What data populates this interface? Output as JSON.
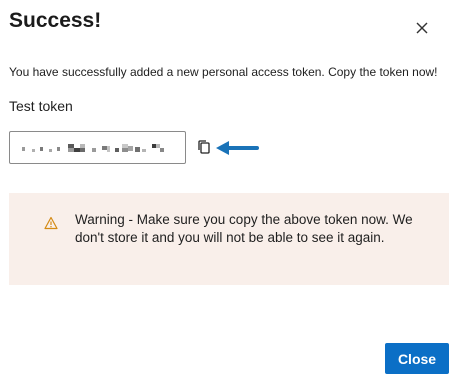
{
  "dialog": {
    "title": "Success!",
    "message": "You have successfully added a new personal access token. Copy the token now!",
    "token_name": "Test token",
    "token_value": "",
    "token_masked": true,
    "warning": {
      "icon": "warning-triangle-icon",
      "text": "Warning - Make sure you copy the above token now. We don't store it and you will not be able to see it again.",
      "background": "#f9efea",
      "icon_color": "#d48a14"
    },
    "close_label": "Close",
    "colors": {
      "primary": "#0b6fc6",
      "annotation_arrow": "#1a73b8"
    }
  }
}
